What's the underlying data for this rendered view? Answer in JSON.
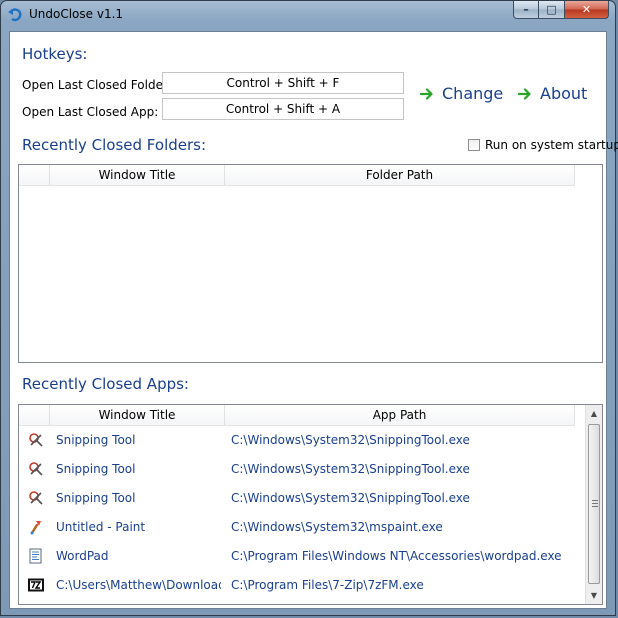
{
  "window": {
    "title": "UndoClose v1.1",
    "controls": {
      "minimize": "–",
      "maximize": "□",
      "close": "✕"
    }
  },
  "hotkeys": {
    "heading": "Hotkeys:",
    "folder_label": "Open Last Closed Folder:",
    "folder_value": "Control + Shift + F",
    "app_label": "Open Last Closed App:",
    "app_value": "Control + Shift + A"
  },
  "actions": {
    "change_label": "Change",
    "about_label": "About",
    "icon": "green-arrow-right-icon"
  },
  "startup": {
    "label": "Run on system startup",
    "checked": false
  },
  "folders": {
    "heading": "Recently Closed Folders:",
    "columns": [
      "Window Title",
      "Folder Path"
    ],
    "rows": []
  },
  "apps": {
    "heading": "Recently Closed Apps:",
    "columns": [
      "Window Title",
      "App Path"
    ],
    "rows": [
      {
        "icon": "snipping-tool-icon",
        "title": "Snipping Tool",
        "path": "C:\\Windows\\System32\\SnippingTool.exe"
      },
      {
        "icon": "snipping-tool-icon",
        "title": "Snipping Tool",
        "path": "C:\\Windows\\System32\\SnippingTool.exe"
      },
      {
        "icon": "snipping-tool-icon",
        "title": "Snipping Tool",
        "path": "C:\\Windows\\System32\\SnippingTool.exe"
      },
      {
        "icon": "paint-icon",
        "title": "Untitled - Paint",
        "path": "C:\\Windows\\System32\\mspaint.exe"
      },
      {
        "icon": "wordpad-icon",
        "title": "WordPad",
        "path": "C:\\Program Files\\Windows NT\\Accessories\\wordpad.exe"
      },
      {
        "icon": "7zip-icon",
        "title": "C:\\Users\\Matthew\\Downloads\\",
        "path": "C:\\Program Files\\7-Zip\\7zFM.exe"
      }
    ]
  },
  "colors": {
    "heading": "#1a3f8f",
    "accent_arrow": "#2aa52a"
  }
}
